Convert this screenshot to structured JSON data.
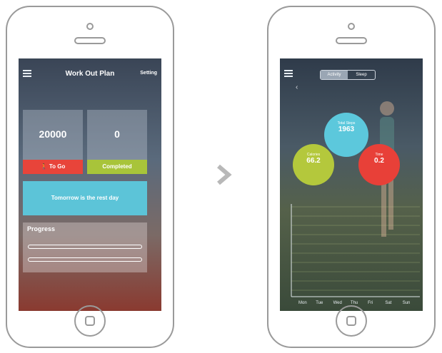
{
  "left_screen": {
    "header": {
      "title": "Work Out Plan",
      "setting_label": "Setting"
    },
    "cards": [
      {
        "value": "20000",
        "button_label": "To Go"
      },
      {
        "value": "0",
        "button_label": "Completed"
      }
    ],
    "rest_message": "Tomorrow is the rest day",
    "progress": {
      "heading": "Progress"
    }
  },
  "right_screen": {
    "tabs": [
      "Activity",
      "Sleep"
    ],
    "circles": [
      {
        "label": "Total Steps",
        "value": "1963"
      },
      {
        "label": "Calories",
        "value": "66.2"
      },
      {
        "label": "Time",
        "value": "0.2"
      }
    ],
    "chart_days": [
      "Mon",
      "Tue",
      "Wed",
      "Thu",
      "Fri",
      "Sat",
      "Sun"
    ]
  },
  "colors": {
    "red": "#e8443a",
    "green": "#a8c43a",
    "cyan": "#5cc4d8"
  }
}
